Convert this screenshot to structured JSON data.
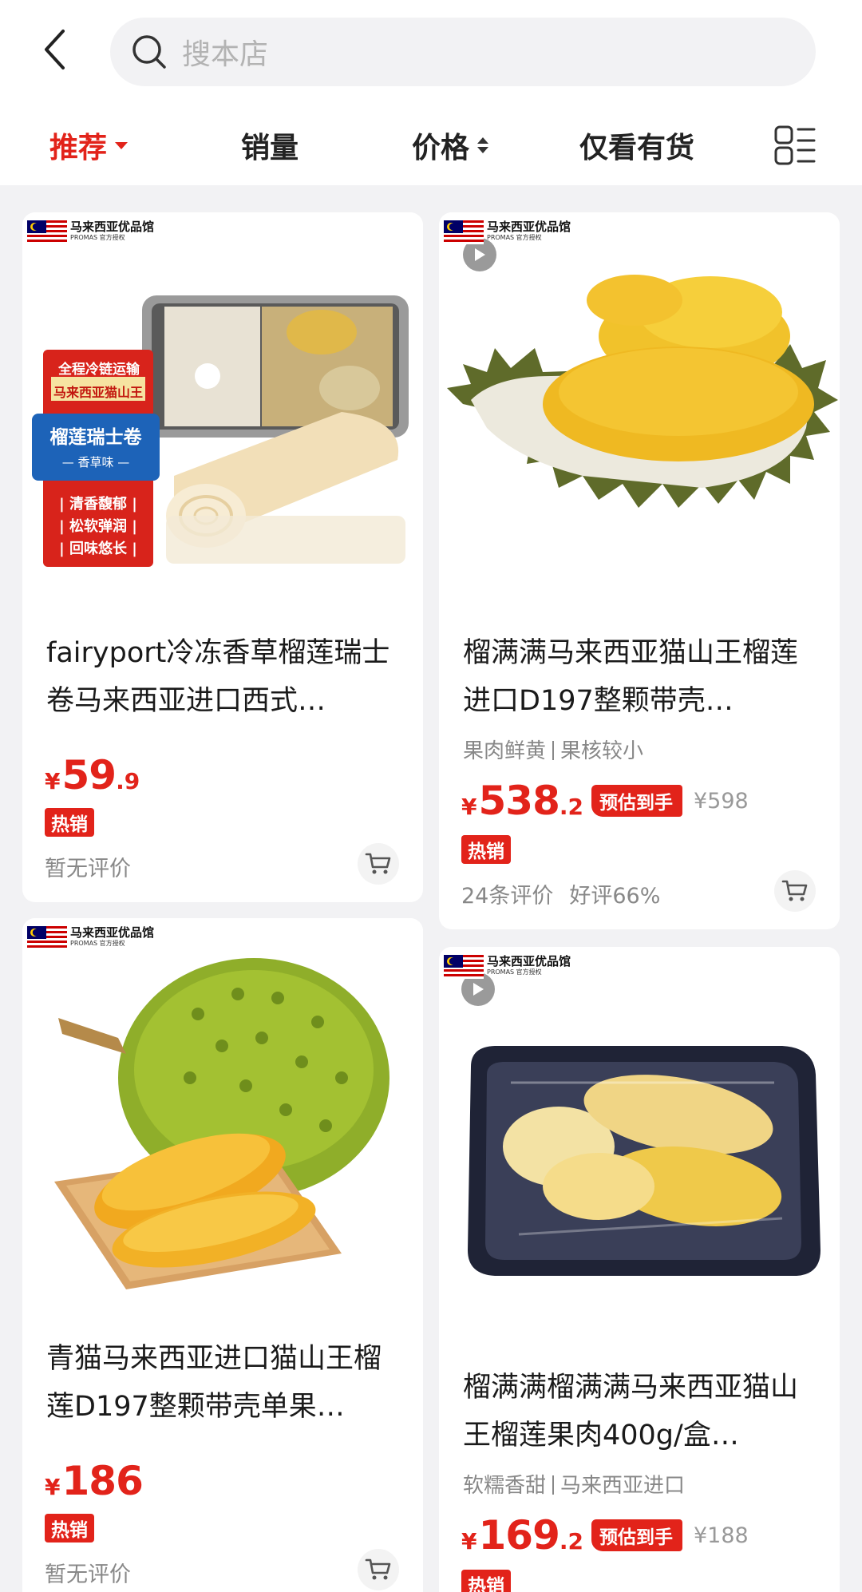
{
  "header": {
    "search_placeholder": "搜本店"
  },
  "sort": {
    "recommend": "推荐",
    "sales": "销量",
    "price": "价格",
    "in_stock_only": "仅看有货"
  },
  "colors": {
    "accent": "#e2231a",
    "page_bg": "#f2f2f4"
  },
  "store_tag": {
    "name": "马来西亚优品馆",
    "sub": "PROMAS 官方授权"
  },
  "products": [
    {
      "title": "fairyport冷冻香草榴莲瑞士卷马来西亚进口西式…",
      "price_int": "59",
      "price_dec": ".9",
      "yen": "¥",
      "hot": "热销",
      "reviews": "暂无评价",
      "has_video": false,
      "package_texts": [
        "全程冷链运输",
        "马来西亚猫山王",
        "榴莲瑞士卷",
        "— 香草味 —",
        "| 清香馥郁 |",
        "| 松软弹润 |",
        "| 回味悠长 |"
      ]
    },
    {
      "title": "榴满满马来西亚猫山王榴莲进口D197整颗带壳…",
      "tags": [
        "果肉鲜黄",
        "果核较小"
      ],
      "price_int": "538",
      "price_dec": ".2",
      "yen": "¥",
      "est_label": "预估到手",
      "orig_price": "¥598",
      "hot": "热销",
      "reviews_count": "24条评价",
      "reviews_good": "好评66%",
      "has_video": true
    },
    {
      "title": "青猫马来西亚进口猫山王榴莲D197整颗带壳单果…",
      "price_int": "186",
      "price_dec": "",
      "yen": "¥",
      "hot": "热销",
      "reviews": "暂无评价",
      "has_video": false
    },
    {
      "title": "榴满满榴满满马来西亚猫山王榴莲果肉400g/盒…",
      "tags": [
        "软糯香甜",
        "马来西亚进口"
      ],
      "price_int": "169",
      "price_dec": ".2",
      "yen": "¥",
      "est_label": "预估到手",
      "orig_price": "¥188",
      "hot": "热销",
      "has_video": true
    }
  ]
}
